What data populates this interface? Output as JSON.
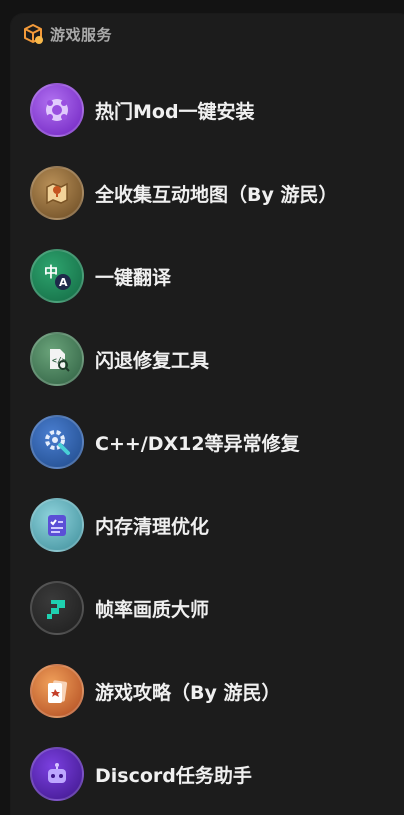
{
  "section": {
    "title": "游戏服务",
    "icon": "package-icon",
    "icon_color": "#f39a3a"
  },
  "items": [
    {
      "label": "热门Mod一键安装",
      "icon": "mod-install-icon",
      "color": "#8a3fd6"
    },
    {
      "label": "全收集互动地图（By 游民）",
      "icon": "map-icon",
      "color": "#8b6a3a"
    },
    {
      "label": "一键翻译",
      "icon": "translate-icon",
      "color": "#1f8a5a"
    },
    {
      "label": "闪退修复工具",
      "icon": "crash-fix-icon",
      "color": "#3f7a5a"
    },
    {
      "label": "C++/DX12等异常修复",
      "icon": "repair-gear-icon",
      "color": "#2f5fa8"
    },
    {
      "label": "内存清理优化",
      "icon": "memory-clean-icon",
      "color": "#4a93a0"
    },
    {
      "label": "帧率画质大师",
      "icon": "fps-master-icon",
      "color": "#2a2a2a"
    },
    {
      "label": "游戏攻略（By 游民）",
      "icon": "game-guide-icon",
      "color": "#c8622e"
    },
    {
      "label": "Discord任务助手",
      "icon": "discord-bot-icon",
      "color": "#5a2aa8"
    }
  ]
}
